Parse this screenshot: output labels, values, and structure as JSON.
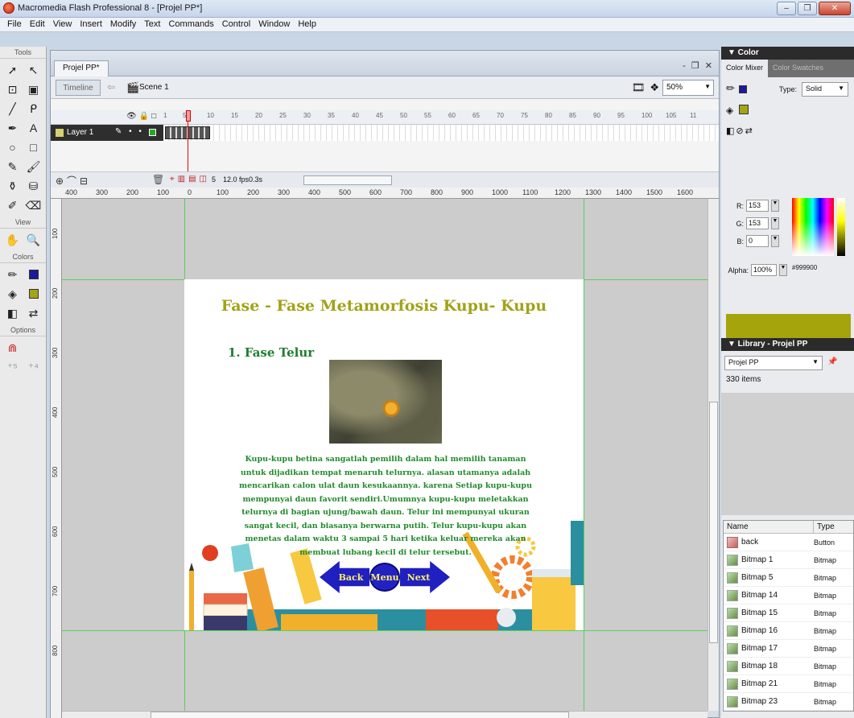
{
  "window": {
    "title": "Macromedia Flash Professional 8 - [Projel PP*]"
  },
  "menu": [
    "File",
    "Edit",
    "View",
    "Insert",
    "Modify",
    "Text",
    "Commands",
    "Control",
    "Window",
    "Help"
  ],
  "tools": {
    "label": "Tools",
    "view_label": "View",
    "colors_label": "Colors",
    "options_label": "Options"
  },
  "document": {
    "tab": "Projel PP*",
    "timeline_button": "Timeline",
    "scene": "Scene 1",
    "zoom": "50%",
    "layer": "Layer 1",
    "frame_numbers": [
      "1",
      "5",
      "10",
      "15",
      "20",
      "25",
      "30",
      "35",
      "40",
      "45",
      "50",
      "55",
      "60",
      "65",
      "70",
      "75",
      "80",
      "85",
      "90",
      "95",
      "100",
      "105",
      "11"
    ],
    "current_frame": "5",
    "fps": "12.0 fps",
    "elapsed": "0.3s"
  },
  "ruler": {
    "top": [
      "400",
      "300",
      "200",
      "100",
      "0",
      "100",
      "200",
      "300",
      "400",
      "500",
      "600",
      "700",
      "800",
      "900",
      "1000",
      "1100",
      "1200",
      "1300",
      "1400",
      "1500",
      "1600"
    ],
    "left": [
      "100",
      "200",
      "300",
      "400",
      "500",
      "600",
      "700",
      "800"
    ]
  },
  "stage": {
    "title": "Fase - Fase Metamorfosis Kupu- Kupu",
    "heading": "1. Fase  Telur",
    "paragraph": "Kupu-kupu betina sangatlah pemilih dalam hal memilih tanaman untuk dijadikan tempat menaruh telurnya. alasan utamanya adalah mencarikan calon ulat daun kesukaannya. karena Setiap kupu-kupu mempunyai daun favorit sendiri.Umumnya kupu-kupu meletakkan telurnya  di bagian ujung/bawah daun. Telur ini mempunyai ukuran sangat kecil, dan biasanya berwarna putih. Telur kupu-kupu akan menetas dalam waktu 3 sampai 5 hari ketika keluar mereka akan membuat lubang kecil di telur tersebut.",
    "back": "Back",
    "menu": "Menu",
    "next": "Next"
  },
  "color_panel": {
    "header": "▼ Color",
    "tabs": [
      "Color Mixer",
      "Color Swatches"
    ],
    "type_label": "Type:",
    "type_value": "Solid",
    "r_label": "R:",
    "r": "153",
    "g_label": "G:",
    "g": "153",
    "b_label": "B:",
    "b": "0",
    "alpha_label": "Alpha:",
    "alpha": "100%",
    "hex": "#999900",
    "fill_color": "#a5a40c"
  },
  "library": {
    "header": "▼ Library - Projel PP",
    "select": "Projel PP",
    "count": "330 items",
    "col_name": "Name",
    "col_type": "Type",
    "items": [
      {
        "name": "back",
        "type": "Button"
      },
      {
        "name": "Bitmap 1",
        "type": "Bitmap"
      },
      {
        "name": "Bitmap 5",
        "type": "Bitmap"
      },
      {
        "name": "Bitmap 14",
        "type": "Bitmap"
      },
      {
        "name": "Bitmap 15",
        "type": "Bitmap"
      },
      {
        "name": "Bitmap 16",
        "type": "Bitmap"
      },
      {
        "name": "Bitmap 17",
        "type": "Bitmap"
      },
      {
        "name": "Bitmap 18",
        "type": "Bitmap"
      },
      {
        "name": "Bitmap 21",
        "type": "Bitmap"
      },
      {
        "name": "Bitmap 23",
        "type": "Bitmap"
      }
    ]
  }
}
